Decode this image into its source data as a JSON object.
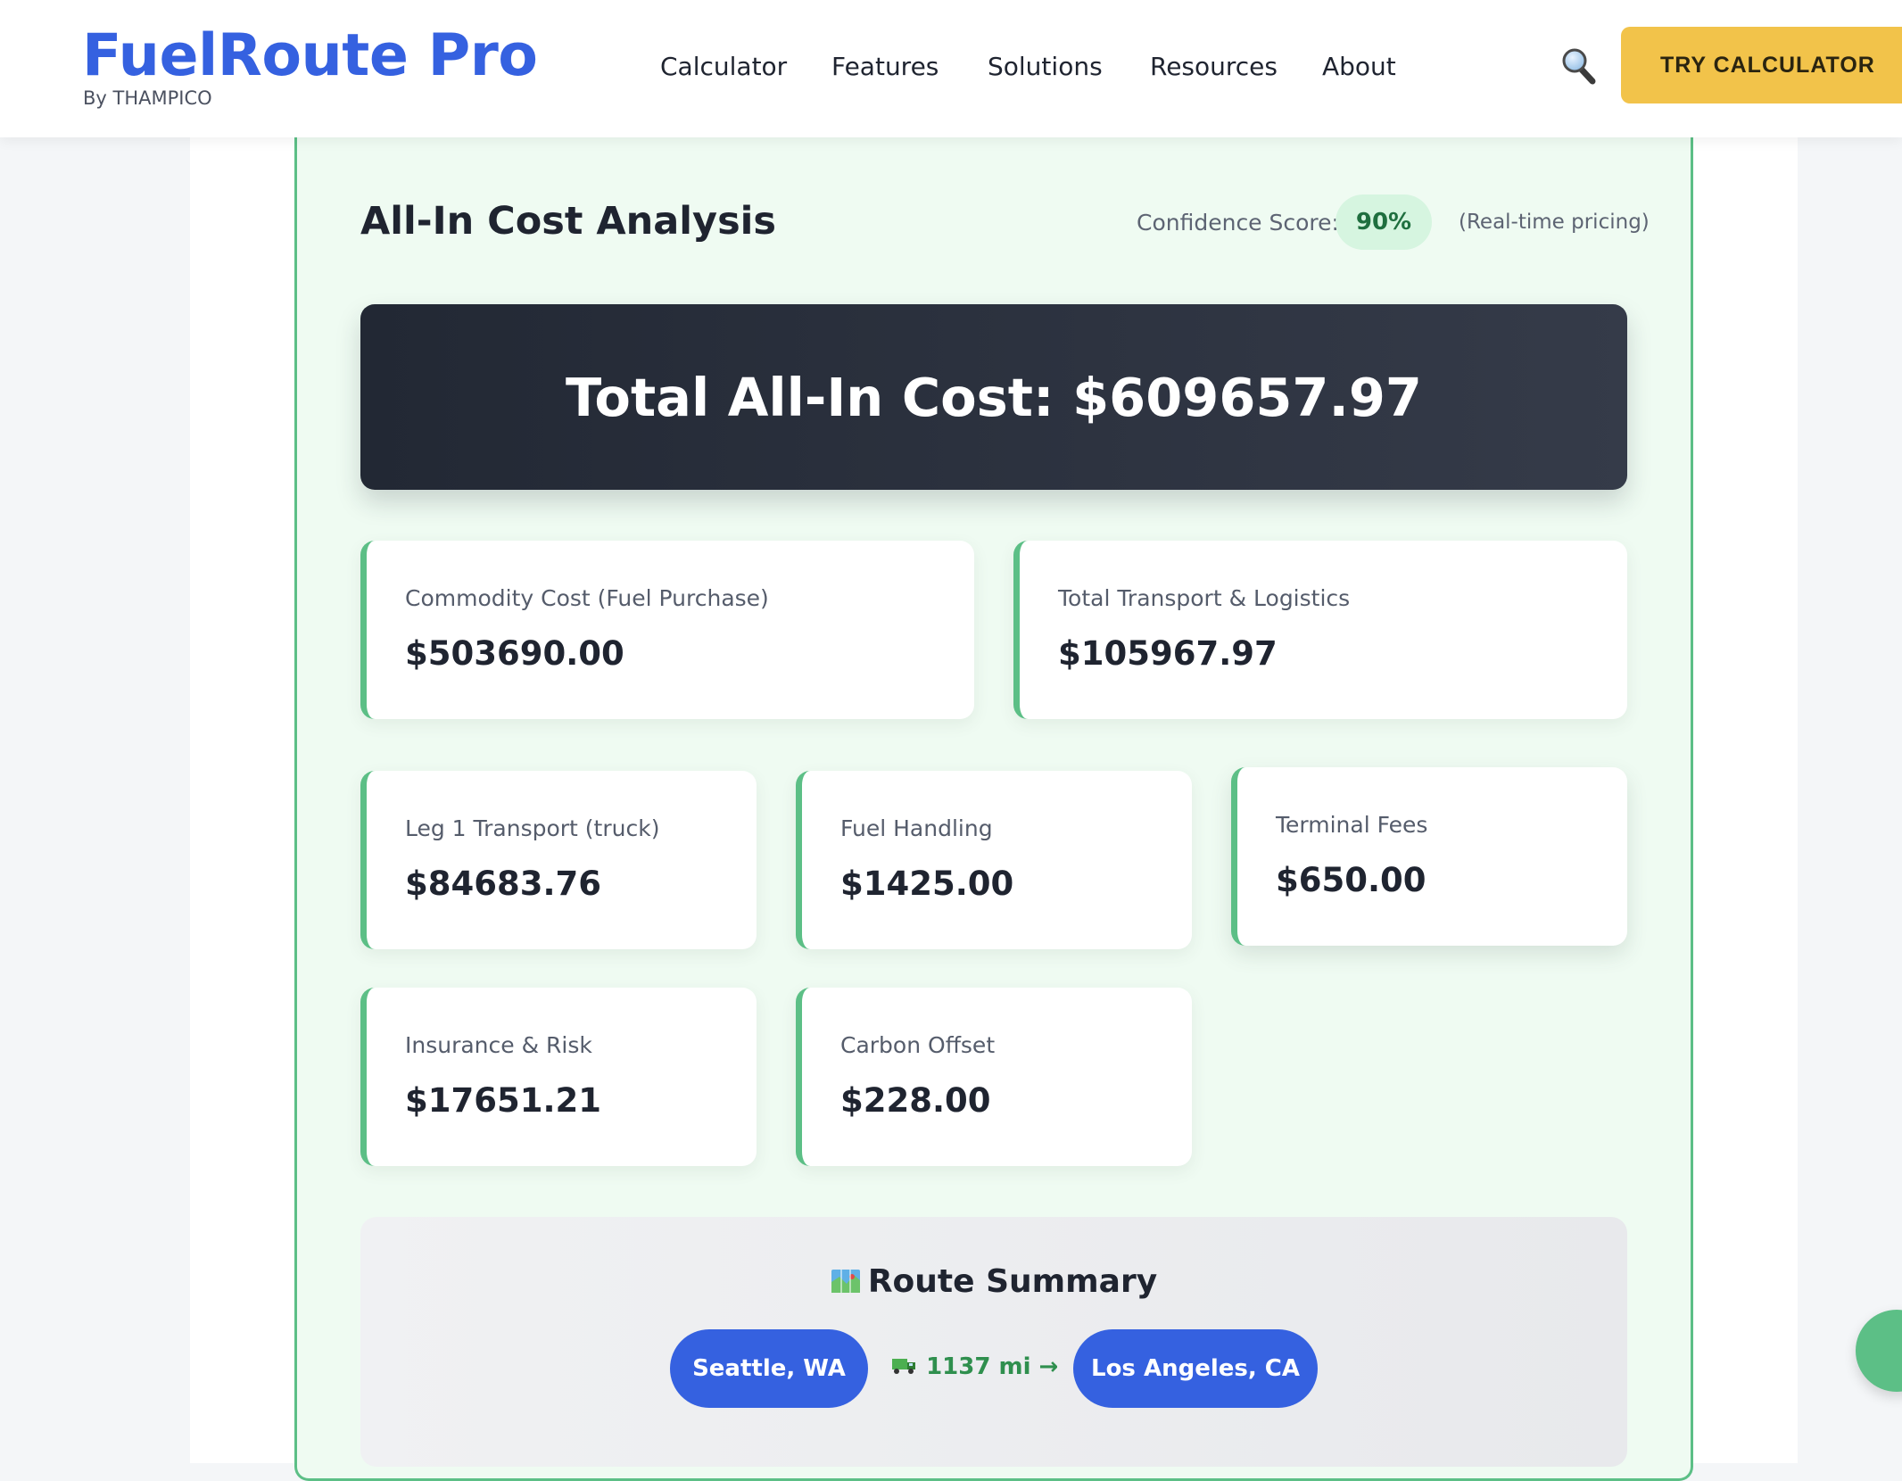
{
  "header": {
    "brand": "FuelRoute Pro",
    "brand_sub": "By THAMPICO",
    "nav": [
      "Calculator",
      "Features",
      "Solutions",
      "Resources",
      "About"
    ],
    "cta": "TRY CALCULATOR",
    "search_icon": "search-icon",
    "brand_color": "#3561e0",
    "cta_color": "#f2c34a"
  },
  "analysis": {
    "title": "All-In Cost Analysis",
    "confidence_label": "Confidence Score:",
    "confidence_value": "90%",
    "confidence_note": "(Real-time pricing)",
    "total": "Total All-In Cost: $609657.97",
    "summary_cards": [
      {
        "label": "Commodity Cost (Fuel Purchase)",
        "value": "$503690.00"
      },
      {
        "label": "Total Transport & Logistics",
        "value": "$105967.97"
      }
    ],
    "detail_cards": [
      {
        "label": "Leg 1 Transport (truck)",
        "value": "$84683.76"
      },
      {
        "label": "Fuel Handling",
        "value": "$1425.00"
      },
      {
        "label": "Terminal Fees",
        "value": "$650.00"
      },
      {
        "label": "Insurance & Risk",
        "value": "$17651.21"
      },
      {
        "label": "Carbon Offset",
        "value": "$228.00"
      }
    ],
    "accent_color": "#5cbf86"
  },
  "route": {
    "icon": "map-icon",
    "title": "Route Summary",
    "origin": "Seattle, WA",
    "distance": "1137 mi →",
    "distance_icon": "truck-icon",
    "destination": "Los Angeles, CA"
  }
}
